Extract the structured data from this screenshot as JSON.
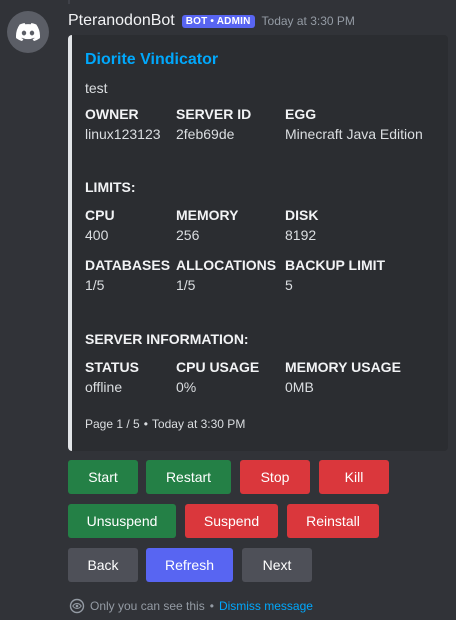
{
  "message": {
    "username": "PteranodonBot",
    "badge": "BOT • ADMIN",
    "timestamp": "Today at 3:30 PM"
  },
  "embed": {
    "title": "Diorite Vindicator",
    "description": "test",
    "accent_color": "#e3e5e8",
    "fields": {
      "owner": {
        "name": "OWNER",
        "value": "linux123123"
      },
      "server_id": {
        "name": "SERVER ID",
        "value": "2feb69de"
      },
      "egg": {
        "name": "EGG",
        "value": "Minecraft Java Edition"
      },
      "limits_heading": "LIMITS:",
      "cpu": {
        "name": "CPU",
        "value": "400"
      },
      "memory": {
        "name": "MEMORY",
        "value": "256"
      },
      "disk": {
        "name": "DISK",
        "value": "8192"
      },
      "databases": {
        "name": "DATABASES",
        "value": "1/5"
      },
      "allocations": {
        "name": "ALLOCATIONS",
        "value": "1/5"
      },
      "backup_limit": {
        "name": "BACKUP LIMIT",
        "value": "5"
      },
      "server_info_heading": "SERVER INFORMATION:",
      "status": {
        "name": "STATUS",
        "value": "offline"
      },
      "cpu_usage": {
        "name": "CPU USAGE",
        "value": "0%"
      },
      "memory_usage": {
        "name": "MEMORY USAGE",
        "value": "0MB"
      }
    },
    "footer": {
      "page": "Page 1 / 5",
      "separator": "•",
      "timestamp": "Today at 3:30 PM"
    }
  },
  "buttons": {
    "start": "Start",
    "restart": "Restart",
    "stop": "Stop",
    "kill": "Kill",
    "unsuspend": "Unsuspend",
    "suspend": "Suspend",
    "reinstall": "Reinstall",
    "back": "Back",
    "refresh": "Refresh",
    "next": "Next"
  },
  "ephemeral": {
    "notice": "Only you can see this",
    "separator": "•",
    "dismiss": "Dismiss message"
  },
  "colors": {
    "success": "#248046",
    "danger": "#da373c",
    "secondary": "#4e5058",
    "primary": "#5865f2",
    "link": "#00a8fc"
  }
}
